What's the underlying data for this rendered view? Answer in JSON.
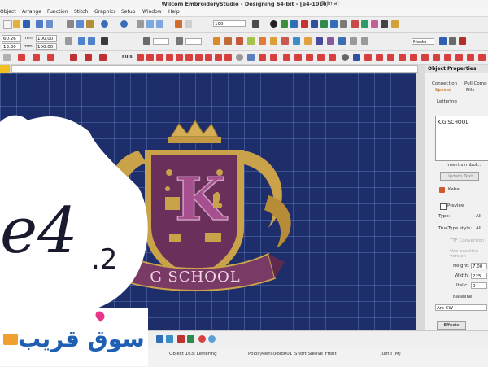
{
  "window": {
    "title": "Wilcom EmbroideryStudio - Designing 64-bit - [e4-1016",
    "machine": "Tajima]"
  },
  "menu": [
    "Object",
    "Arrange",
    "Function",
    "Stitch",
    "Graphics",
    "Setup",
    "Window",
    "Help"
  ],
  "toolbar": {
    "pos_x": "60.26",
    "pos_y": "13.30",
    "width_val": "100.00",
    "height_val": "100.00",
    "unit1": "mm",
    "unit2": "mm",
    "zoom": "100",
    "fill_label": "Fills",
    "font_dropdown": "Mesto"
  },
  "canvas": {
    "design_text": "G SCHOOL",
    "monogram": "K",
    "crest_colors": {
      "shield": "#6b2f5c",
      "gold": "#c9a24a",
      "ribbon": "#7a3a66"
    }
  },
  "watermark": {
    "version_main": "e4",
    "version_sub": ".2"
  },
  "panel": {
    "title": "Object Properties",
    "tabs": [
      "Connection",
      "Pull Comp",
      "Special",
      "Fills"
    ],
    "section": "Lettering",
    "text_value": "K.G SCHOOL",
    "insert_symbol": "Insert symbol...",
    "update_text": "Update Text",
    "kind_label": "Kabel",
    "preview_label": "Preview",
    "type_label": "Type:",
    "type_value": "All",
    "truetype_label": "TrueType style:",
    "truetype_value": "All",
    "tt_conversion": "TTF Conversion",
    "use_baseline": "Use baseline version",
    "height_label": "Height:",
    "height_value": "7.00",
    "width_label": "Width:",
    "width_value": "225",
    "italic_label": "Italic:",
    "italic_value": "0",
    "baseline_label": "Baseline",
    "baseline_value": "Arc CW",
    "effects_button": "Effects"
  },
  "statusbar": {
    "object_info": "Object 163: Lettering",
    "file": "Polos\\Mens\\Polo001_Short Sleeve_Front",
    "jump": "Jump (M)"
  },
  "store_logo": {
    "text": "سوق قريب",
    "colors": {
      "blue": "#1f5fb3",
      "pink": "#e8348b",
      "orange": "#f0a030"
    }
  }
}
